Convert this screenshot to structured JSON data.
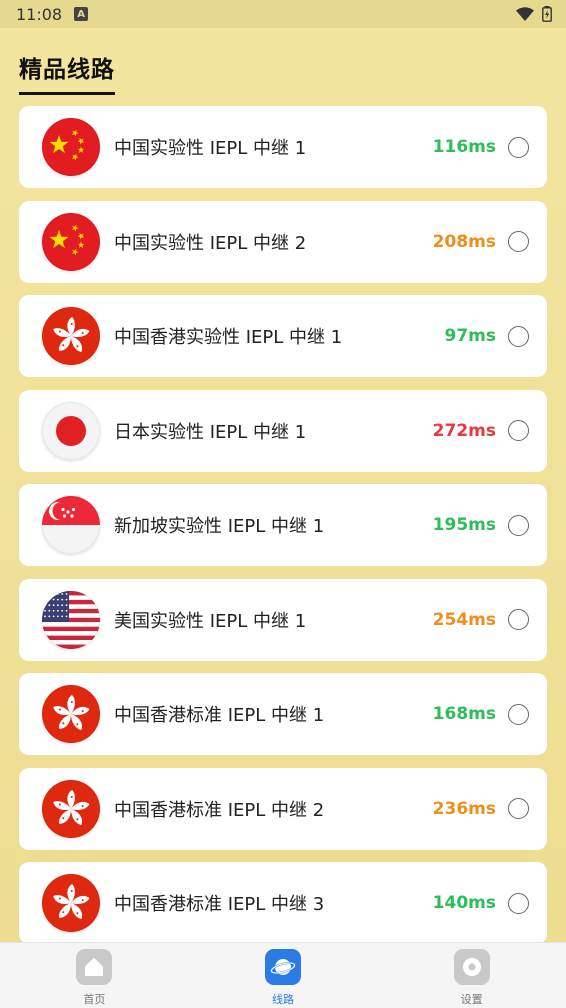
{
  "status_bar": {
    "time": "11:08",
    "badge": "A"
  },
  "page": {
    "title": "精品线路"
  },
  "colors": {
    "fast": "#2dbd5a",
    "medium": "#ef8e1c",
    "slow": "#e8383d",
    "accent": "#2a7be4"
  },
  "routes": [
    {
      "flag": "china-flag-icon",
      "name": "中国实验性 IEPL 中继 1",
      "latency": "116ms",
      "level": "fast"
    },
    {
      "flag": "china-flag-icon",
      "name": "中国实验性 IEPL 中继 2",
      "latency": "208ms",
      "level": "medium"
    },
    {
      "flag": "hong-kong-flag-icon",
      "name": "中国香港实验性 IEPL 中继 1",
      "latency": "97ms",
      "level": "fast"
    },
    {
      "flag": "japan-flag-icon",
      "name": "日本实验性 IEPL 中继 1",
      "latency": "272ms",
      "level": "slow"
    },
    {
      "flag": "singapore-flag-icon",
      "name": "新加坡实验性 IEPL 中继 1",
      "latency": "195ms",
      "level": "fast"
    },
    {
      "flag": "usa-flag-icon",
      "name": "美国实验性 IEPL 中继 1",
      "latency": "254ms",
      "level": "medium"
    },
    {
      "flag": "hong-kong-flag-icon",
      "name": "中国香港标准 IEPL 中继 1",
      "latency": "168ms",
      "level": "fast"
    },
    {
      "flag": "hong-kong-flag-icon",
      "name": "中国香港标准 IEPL 中继 2",
      "latency": "236ms",
      "level": "medium"
    },
    {
      "flag": "hong-kong-flag-icon",
      "name": "中国香港标准 IEPL 中继 3",
      "latency": "140ms",
      "level": "fast"
    }
  ],
  "tabs": [
    {
      "label": "首页",
      "icon": "home-icon",
      "active": false
    },
    {
      "label": "线路",
      "icon": "planet-icon",
      "active": true
    },
    {
      "label": "设置",
      "icon": "settings-icon",
      "active": false
    }
  ]
}
